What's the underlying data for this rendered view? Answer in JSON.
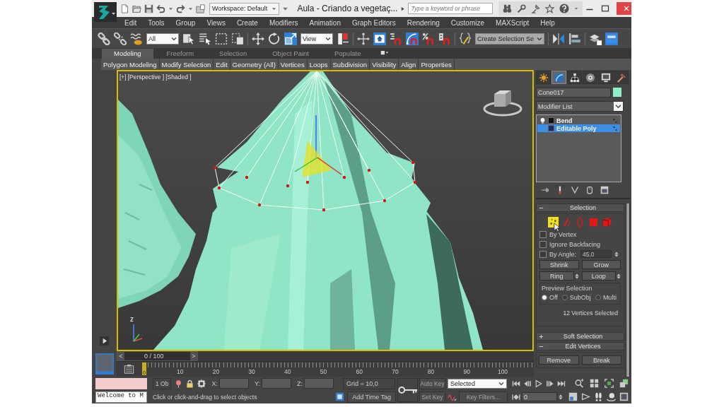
{
  "window": {
    "title": "Aula - Criando a vegetaç...",
    "workspace": "Workspace: Default",
    "search": {
      "placeholder": "Type a keyword or phrase"
    }
  },
  "menu": [
    "Edit",
    "Tools",
    "Group",
    "Views",
    "Create",
    "Modifiers",
    "Animation",
    "Graph Editors",
    "Rendering",
    "Customize",
    "MAXScript",
    "Help"
  ],
  "main_toolbar": [
    {
      "kind": "tool",
      "selected": false
    },
    {
      "kind": "tool",
      "selected": false
    },
    {
      "kind": "tool",
      "selected": false
    },
    {
      "kind": "dropdown",
      "value": "All",
      "disabled": false
    },
    {
      "kind": "tool",
      "selected": false
    },
    {
      "kind": "tool",
      "selected": false
    },
    {
      "kind": "tool",
      "selected": false
    },
    {
      "kind": "tool",
      "selected": false
    },
    {
      "kind": "tool",
      "selected": false
    },
    {
      "kind": "tool",
      "selected": false
    },
    {
      "kind": "tool",
      "selected": true
    },
    {
      "kind": "dropdown",
      "value": "View",
      "disabled": false
    },
    {
      "kind": "tool",
      "selected": false
    },
    {
      "kind": "tool",
      "selected": false
    },
    {
      "kind": "tool",
      "selected": true
    },
    {
      "kind": "tool",
      "selected": false
    },
    {
      "kind": "tool",
      "selected": true
    },
    {
      "kind": "tool",
      "selected": false
    },
    {
      "kind": "tool",
      "selected": false
    },
    {
      "kind": "tool",
      "selected": false
    },
    {
      "kind": "dropdown",
      "value": "Create Selection Se",
      "disabled": true
    },
    {
      "kind": "tool",
      "selected": false
    },
    {
      "kind": "tool",
      "selected": false
    },
    {
      "kind": "tool",
      "selected": false
    },
    {
      "kind": "tool",
      "selected": true
    }
  ],
  "ribbon": {
    "tabs": [
      {
        "label": "Modeling",
        "selected": true
      },
      {
        "label": "Freeform",
        "selected": false
      },
      {
        "label": "Selection",
        "selected": false
      },
      {
        "label": "Object Paint",
        "selected": false
      },
      {
        "label": "Populate",
        "selected": false
      }
    ],
    "panels": [
      "Polygon Modeling",
      "Modify Selection",
      "Edit",
      "Geometry (All)",
      "Vertices",
      "Loops",
      "Subdivision",
      "Visibility",
      "Align",
      "Properties"
    ]
  },
  "viewport": {
    "active": true,
    "label": [
      "[+]",
      "[Perspective ]",
      "[Shaded ]"
    ],
    "axis_label": "z"
  },
  "time_slider": {
    "prev": "<",
    "label": "0 / 100",
    "next": ">",
    "level": 0
  },
  "track_bar": {
    "frame_marker": "0",
    "tick_labels": [
      "10",
      "20",
      "30",
      "40",
      "50",
      "60",
      "70",
      "80",
      "90",
      "100"
    ]
  },
  "command_panel": {
    "tabs": [
      {
        "selected": false
      },
      {
        "selected": true
      },
      {
        "selected": false
      },
      {
        "selected": false
      },
      {
        "selected": false
      },
      {
        "selected": false
      }
    ],
    "object": {
      "name": "Cone017",
      "color": "#8fefc9"
    },
    "modifier_list": "Modifier List",
    "stack": [
      {
        "label": "Bend",
        "kind": "modifier",
        "selected": false
      },
      {
        "label": "Editable Poly",
        "kind": "object",
        "selected": true
      }
    ],
    "rollouts": [
      {
        "kind": "selection",
        "title": "Selection",
        "expanded": true,
        "levels": [
          {
            "selected": true
          },
          {
            "selected": false
          },
          {
            "selected": false
          },
          {
            "selected": false
          },
          {
            "selected": false
          }
        ],
        "checkboxes": [
          {
            "label": "By Vertex",
            "checked": false
          },
          {
            "label": "Ignore Backfacing",
            "checked": false
          },
          {
            "label": "By Angle:",
            "checked": false
          }
        ],
        "angle": {
          "value": "45,0",
          "disabled": true
        },
        "buttons": [
          {
            "label": "Shrink",
            "spinner": false
          },
          {
            "label": "Grow",
            "spinner": false
          },
          {
            "label": "Ring",
            "spinner": true
          },
          {
            "label": "Loop",
            "spinner": true
          }
        ],
        "preview": {
          "title": "Preview Selection",
          "options": [
            {
              "label": "Off",
              "selected": true
            },
            {
              "label": "SubObj",
              "selected": false
            },
            {
              "label": "Multi",
              "selected": false
            }
          ]
        },
        "status": "12 Vertices Selected"
      },
      {
        "kind": "empty",
        "title": "Soft Selection",
        "expanded": false
      },
      {
        "kind": "buttons",
        "title": "Edit Vertices",
        "expanded": true,
        "buttons": [
          "Remove",
          "Break"
        ]
      }
    ]
  },
  "status_bar": {
    "listener_output": "Welcome to M",
    "selection": "1 Ob",
    "coordinates": [
      "X:",
      "Y:",
      "Z:"
    ],
    "grid": "Grid = 10,0",
    "prompt": "Click or click-and-drag to select objects",
    "time_tag": "Add Time Tag",
    "auto_key": {
      "label": "Auto Key",
      "on": false
    },
    "set_key": "Set Key",
    "key_mode": "Selected",
    "key_filters": "Key Filters...",
    "frame": "0"
  }
}
